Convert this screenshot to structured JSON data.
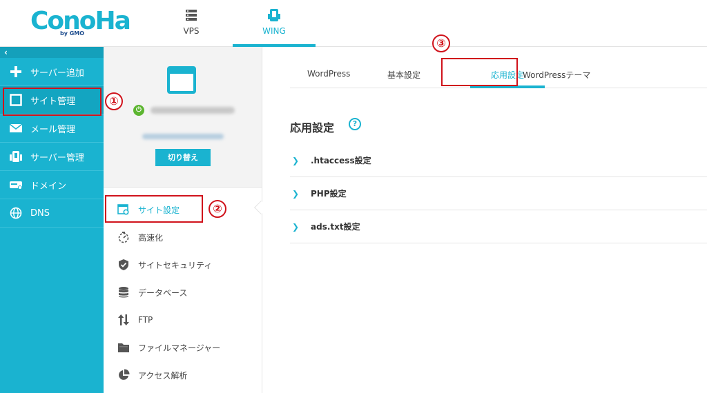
{
  "header": {
    "logo_text": "ConoHa",
    "logo_sub": "by GMO",
    "tabs": [
      {
        "label": "VPS",
        "icon": "server-icon"
      },
      {
        "label": "WING",
        "icon": "wing-icon"
      }
    ],
    "active_tab": "WING"
  },
  "leftnav": {
    "collapse_glyph": "‹",
    "items": [
      {
        "label": "サーバー追加",
        "icon": "plus-icon"
      },
      {
        "label": "サイト管理",
        "icon": "window-icon"
      },
      {
        "label": "メール管理",
        "icon": "mail-icon"
      },
      {
        "label": "サーバー管理",
        "icon": "server-manage-icon"
      },
      {
        "label": "ドメイン",
        "icon": "domain-icon"
      },
      {
        "label": "DNS",
        "icon": "globe-icon"
      }
    ]
  },
  "site_panel": {
    "switch_label": "切り替え",
    "submenu": [
      {
        "label": "サイト設定",
        "icon": "site-settings-icon"
      },
      {
        "label": "高速化",
        "icon": "stopwatch-icon"
      },
      {
        "label": "サイトセキュリティ",
        "icon": "shield-icon"
      },
      {
        "label": "データベース",
        "icon": "database-icon"
      },
      {
        "label": "FTP",
        "icon": "transfer-icon"
      },
      {
        "label": "ファイルマネージャー",
        "icon": "folder-icon"
      },
      {
        "label": "アクセス解析",
        "icon": "pie-chart-icon"
      }
    ]
  },
  "main": {
    "tabs": [
      {
        "label": "WordPress"
      },
      {
        "label": "基本設定"
      },
      {
        "label": "応用設定"
      },
      {
        "label": "WordPressテーマ"
      }
    ],
    "active_tab": "応用設定",
    "section_title": "応用設定",
    "help_glyph": "?",
    "rows": [
      {
        "label": ".htaccess設定"
      },
      {
        "label": "PHP設定"
      },
      {
        "label": "ads.txt設定"
      }
    ]
  },
  "annotations": {
    "callouts": [
      "①",
      "②",
      "③"
    ],
    "color": "#d0121b"
  },
  "colors": {
    "accent": "#1ab3d0",
    "power_on": "#5cb530"
  }
}
